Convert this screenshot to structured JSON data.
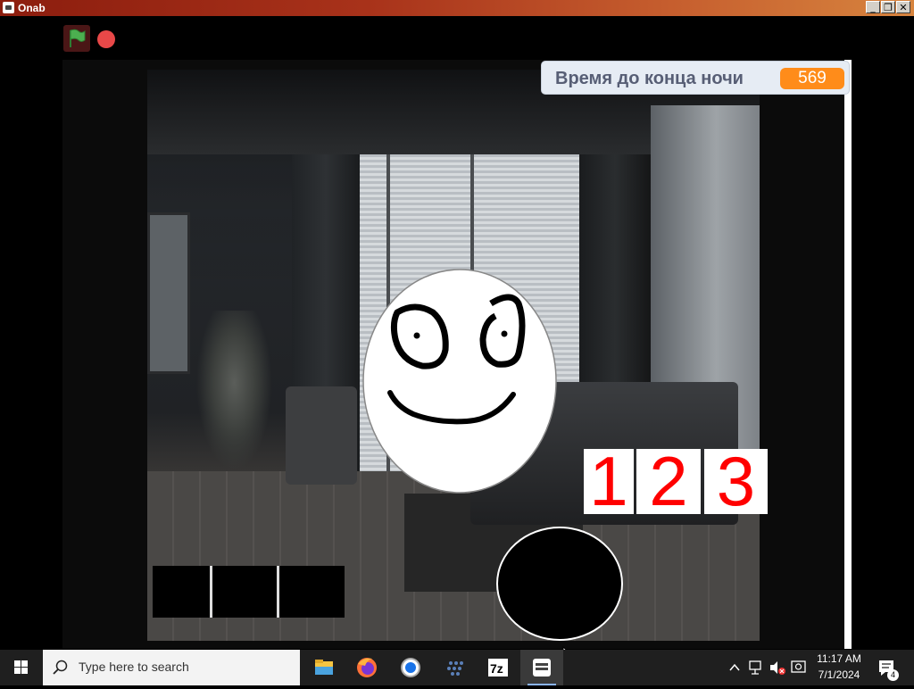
{
  "window": {
    "title": "Onab",
    "buttons": {
      "minimize": "_",
      "restore": "❐",
      "close": "✕"
    }
  },
  "controls": {
    "flag_icon": "green-flag-icon",
    "stop_icon": "stop-icon",
    "flag_color": "#4caf50",
    "stop_color": "#e84848"
  },
  "game": {
    "timer": {
      "label": "Время до конца ночи",
      "value": "569"
    },
    "number_cards": [
      "1",
      "2",
      "3"
    ],
    "number_color": "#ff0000",
    "accent": "#ff8c1a"
  },
  "taskbar": {
    "search_placeholder": "Type here to search",
    "apps": [
      "file-explorer",
      "firefox",
      "chrome",
      "blackberry",
      "7zip",
      "scratch"
    ],
    "clock": {
      "time": "11:17 AM",
      "date": "7/1/2024"
    },
    "notifications": "4"
  }
}
